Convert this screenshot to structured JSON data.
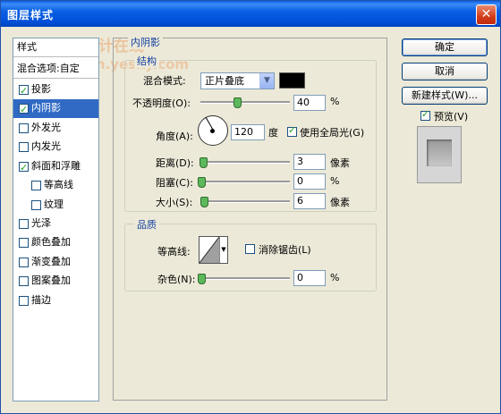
{
  "window": {
    "title": "图层样式",
    "close_glyph": "✕"
  },
  "watermark": {
    "line1": "天极设计在线",
    "line2": "ign.yesky.com"
  },
  "styles_list": {
    "header": "样式",
    "blend_options": "混合选项:自定",
    "items": [
      {
        "label": "投影",
        "checked": true
      },
      {
        "label": "内阴影",
        "checked": true,
        "selected": true
      },
      {
        "label": "外发光",
        "checked": false
      },
      {
        "label": "内发光",
        "checked": false
      },
      {
        "label": "斜面和浮雕",
        "checked": true
      },
      {
        "label": "等高线",
        "checked": false,
        "sub": true
      },
      {
        "label": "纹理",
        "checked": false,
        "sub": true
      },
      {
        "label": "光泽",
        "checked": false
      },
      {
        "label": "颜色叠加",
        "checked": false
      },
      {
        "label": "渐变叠加",
        "checked": false
      },
      {
        "label": "图案叠加",
        "checked": false
      },
      {
        "label": "描边",
        "checked": false
      }
    ]
  },
  "panel": {
    "title": "内阴影",
    "structure": {
      "title": "结构",
      "blend_mode_label": "混合模式:",
      "blend_mode_value": "正片叠底",
      "swatch_color": "#000000",
      "opacity_label": "不透明度(O):",
      "opacity_value": "40",
      "opacity_unit": "%",
      "angle_label": "角度(A):",
      "angle_value": "120",
      "angle_unit": "度",
      "global_light_label": "使用全局光(G)",
      "global_light_checked": true,
      "distance_label": "距离(D):",
      "distance_value": "3",
      "distance_unit": "像素",
      "choke_label": "阻塞(C):",
      "choke_value": "0",
      "choke_unit": "%",
      "size_label": "大小(S):",
      "size_value": "6",
      "size_unit": "像素"
    },
    "quality": {
      "title": "品质",
      "contour_label": "等高线:",
      "antialias_label": "消除锯齿(L)",
      "antialias_checked": false,
      "noise_label": "杂色(N):",
      "noise_value": "0",
      "noise_unit": "%"
    }
  },
  "buttons": {
    "ok": "确定",
    "cancel": "取消",
    "new_style": "新建样式(W)...",
    "preview_label": "预览(V)",
    "preview_checked": true
  }
}
